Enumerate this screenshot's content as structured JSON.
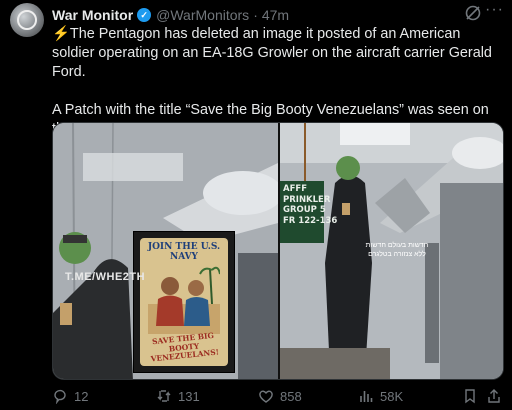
{
  "post": {
    "author_name": "War Monitor",
    "handle": "@WarMonitors",
    "separator": "·",
    "time": "47m",
    "more_label": "···",
    "text_emoji": "⚡",
    "text": "The Pentagon has deleted an image it posted of an American soldier operating on an EA-18G Growler on the aircraft carrier Gerald Ford.\n\nA Patch with the title “Save the Big Booty Venezuelans” was seen on the soldier."
  },
  "media": {
    "watermark": "T.ME/WHE2TH",
    "sign_text": "AFFF\nPRINKLER\nGROUP 5\nFR 122-136",
    "overlay_text": "חדשות בעולם חדשות\nללא צנזורה בטלגרם",
    "patch_title": "JOIN THE U.S. NAVY",
    "patch_subtitle": "SAVE THE BIG BOOTY VENEZUELANS!"
  },
  "actions": {
    "replies": "12",
    "reposts": "131",
    "likes": "858",
    "views": "58K"
  },
  "colors": {
    "background": "#000000",
    "text": "#e7e9ea",
    "muted": "#71767b",
    "verified": "#1d9bf0",
    "bolt": "#ffac33"
  },
  "icons": [
    "verified-badge-icon",
    "grok-icon",
    "more-icon",
    "reply-icon",
    "repost-icon",
    "like-icon",
    "views-icon",
    "bookmark-icon",
    "share-icon"
  ]
}
